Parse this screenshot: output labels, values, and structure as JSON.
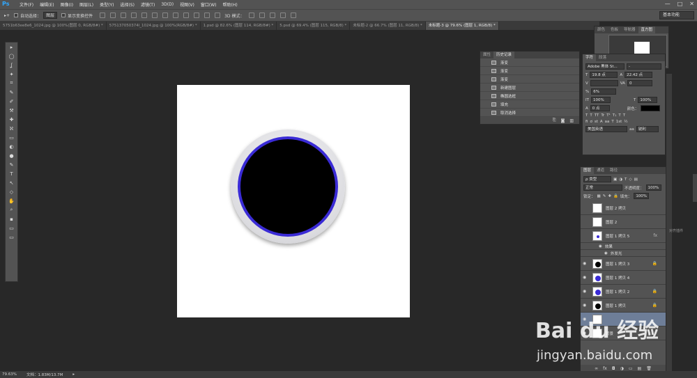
{
  "menu": {
    "logo": "Ps",
    "items": [
      "文件(F)",
      "编辑(E)",
      "图像(I)",
      "图层(L)",
      "类型(Y)",
      "选择(S)",
      "滤镜(T)",
      "3D(D)",
      "视图(V)",
      "窗口(W)",
      "帮助(H)"
    ],
    "window_controls": [
      "—",
      "□",
      "✕"
    ]
  },
  "options": {
    "auto_select_label": "自动选择：",
    "auto_select_value": "图层",
    "show_transform_label": "显示变换控件",
    "mode_3d_label": "3D 模式：",
    "workspace": "基本功能"
  },
  "tabs": [
    {
      "label": "5751b63ee8e6_1024.jpg @ 100%(图层 0, RGB/8#) *",
      "active": false
    },
    {
      "label": "575137050374l_1024.jpg @ 100%(RGB/8#) *",
      "active": false
    },
    {
      "label": "1.psd @ 82.6% (图层 114, RGB/8#) *",
      "active": false
    },
    {
      "label": "5.psd @ 69.4% (图层 115, RGB/8) *",
      "active": false
    },
    {
      "label": "未标题-2 @ 66.7% (图层 11, RGB/8) *",
      "active": false
    },
    {
      "label": "未标题-3 @ 79.6% (图层 1, RGB/8) *",
      "active": true
    }
  ],
  "tools": [
    "▸",
    "◯",
    "ʆ",
    "✦",
    "⌗",
    "✎",
    "✐",
    "⚒",
    "✚",
    "ℵ",
    "▭",
    "◐",
    "●",
    "✎",
    "T",
    "↖",
    "◇",
    "✋",
    "⌕",
    "▪",
    "▭",
    "▭"
  ],
  "history": {
    "tabs": [
      "属性",
      "历史记录"
    ],
    "rows": [
      "渐变",
      "渐变",
      "渐变",
      "新建图层",
      "椭圆选框",
      "填充",
      "取消选择"
    ]
  },
  "navigator": {
    "tabs": [
      "颜色",
      "色板",
      "导航器",
      "直方图"
    ]
  },
  "character": {
    "tabs": [
      "字符",
      "段落"
    ],
    "font_family": "Adobe 黑体 St...",
    "font_style": "-",
    "size": "19.8 点",
    "leading": "22.42 点",
    "tracking": "0",
    "scale_pct": "6%",
    "baseline": "0 点",
    "v_scale": "100%",
    "h_scale": "100%",
    "color_label": "颜色：",
    "style_buttons": [
      "T",
      "T",
      "TT",
      "Tr",
      "T¹",
      "T₁",
      "T",
      "T"
    ],
    "language": "美国英语",
    "aa_label": "aa",
    "aa_value": "锐利"
  },
  "layers": {
    "tabs": [
      "图层",
      "通道",
      "路径"
    ],
    "filter": "ρ 类型",
    "blend_mode": "正常",
    "opacity_label": "不透明度：",
    "opacity": "100%",
    "lock_label": "锁定：",
    "fill_label": "填充：",
    "fill": "100%",
    "rows": [
      {
        "name": "图层 2 拷贝",
        "visible": false,
        "thumb": "none"
      },
      {
        "name": "图层 2",
        "visible": false,
        "thumb": "none"
      },
      {
        "name": "图层 1 拷贝 5",
        "visible": false,
        "thumb": "blue",
        "fx": "fx"
      },
      {
        "name": "效果",
        "sub": true
      },
      {
        "name": "外发光",
        "sub": true
      },
      {
        "name": "图层 1 拷贝 3",
        "visible": true,
        "thumb": "black"
      },
      {
        "name": "图层 1 拷贝 4",
        "visible": true,
        "thumb": "blue"
      },
      {
        "name": "图层 1 拷贝 2",
        "visible": true,
        "thumb": "blue"
      },
      {
        "name": "图层 1 拷贝",
        "visible": true,
        "thumb": "black"
      },
      {
        "name": "",
        "visible": true,
        "thumb": "none"
      },
      {
        "name": "背景",
        "visible": true,
        "thumb": "none"
      }
    ],
    "footer_icons": [
      "∞",
      "fx",
      "◘",
      "◑",
      "▭",
      "▤",
      "🗑"
    ]
  },
  "status": {
    "zoom": "79.63%",
    "doc": "文档：1.83M/13.7M",
    "arrow": "▸"
  },
  "side_note": "对齐插件",
  "watermark": {
    "text": "Bai du 经验",
    "sub": "jingyan.baidu.com"
  }
}
